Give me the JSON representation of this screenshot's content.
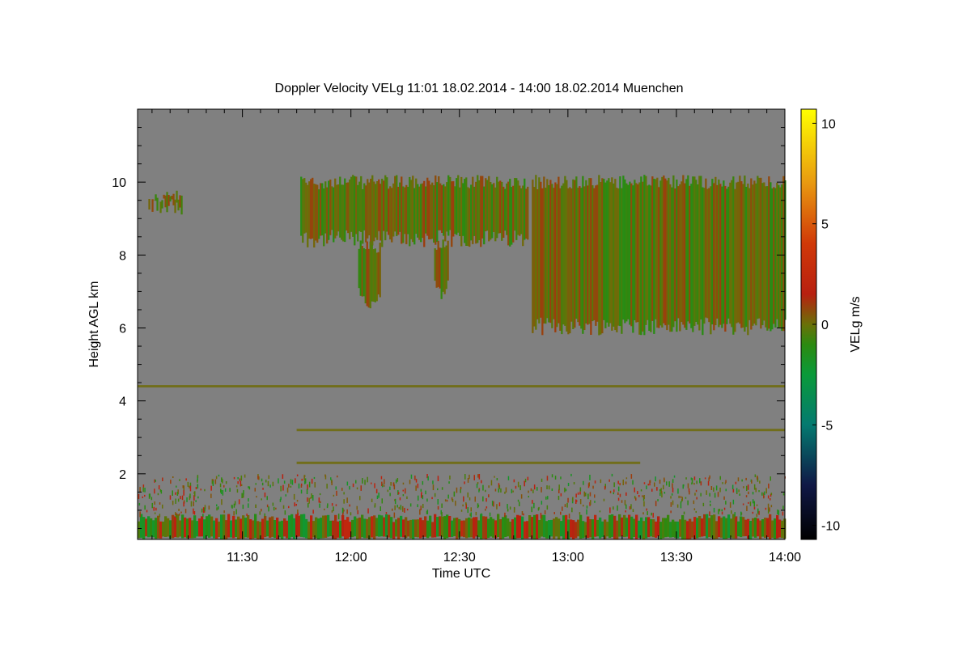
{
  "chart_data": {
    "type": "heatmap",
    "title": "Doppler Velocity VELg   11:01 18.02.2014 - 14:00 18.02.2014 Muenchen",
    "xlabel": "Time UTC",
    "ylabel": "Height AGL km",
    "colorbar_label": "VELg m/s",
    "x_range": [
      "11:01",
      "14:00"
    ],
    "xlim_minutes": [
      661,
      840
    ],
    "ylim_km": [
      0.2,
      12.0
    ],
    "x_ticks": [
      {
        "label": "11:30",
        "minutes": 690
      },
      {
        "label": "12:00",
        "minutes": 720
      },
      {
        "label": "12:30",
        "minutes": 750
      },
      {
        "label": "13:00",
        "minutes": 780
      },
      {
        "label": "13:30",
        "minutes": 810
      },
      {
        "label": "14:00",
        "minutes": 840
      }
    ],
    "y_ticks": [
      {
        "label": "2",
        "value": 2
      },
      {
        "label": "4",
        "value": 4
      },
      {
        "label": "6",
        "value": 6
      },
      {
        "label": "8",
        "value": 8
      },
      {
        "label": "10",
        "value": 10
      }
    ],
    "colorbar_ticks": [
      {
        "label": "10",
        "value": 10
      },
      {
        "label": "5",
        "value": 5
      },
      {
        "label": "0",
        "value": 0
      },
      {
        "label": "-5",
        "value": -5
      },
      {
        "label": "-10",
        "value": -10
      }
    ],
    "colorbar_range": [
      -10.7,
      10.7
    ],
    "background_color": "#808080",
    "colormap": [
      {
        "v": -10.7,
        "c": "#000000"
      },
      {
        "v": -8,
        "c": "#101846"
      },
      {
        "v": -5,
        "c": "#047a70"
      },
      {
        "v": -2.5,
        "c": "#0a9a3a"
      },
      {
        "v": -1,
        "c": "#2c8a10"
      },
      {
        "v": 0,
        "c": "#6a7008"
      },
      {
        "v": 1.5,
        "c": "#b82010"
      },
      {
        "v": 4,
        "c": "#d03808"
      },
      {
        "v": 7,
        "c": "#e89810"
      },
      {
        "v": 10.7,
        "c": "#ffff00"
      }
    ],
    "regions": [
      {
        "name": "cirrus-upper-left",
        "t": [
          664,
          673
        ],
        "h": [
          9.1,
          9.8
        ]
      },
      {
        "name": "cirrus-main-deck",
        "t": [
          706,
          769
        ],
        "h": [
          8.2,
          10.2
        ]
      },
      {
        "name": "fallstreak-1",
        "t": [
          722,
          728
        ],
        "h": [
          6.4,
          8.4
        ]
      },
      {
        "name": "fallstreak-2",
        "t": [
          743,
          747
        ],
        "h": [
          6.7,
          8.5
        ]
      },
      {
        "name": "cirrus-right-deck",
        "t": [
          770,
          840
        ],
        "h": [
          5.8,
          10.2
        ]
      },
      {
        "name": "boundary-layer-clutter",
        "t": [
          661,
          840
        ],
        "h": [
          0.2,
          0.9
        ]
      }
    ],
    "levels": [
      {
        "name": "streak-4.4km",
        "t": [
          661,
          840
        ],
        "h": 4.4
      },
      {
        "name": "streak-3.2km",
        "t": [
          705,
          840
        ],
        "h": 3.2
      },
      {
        "name": "streak-2.3km",
        "t": [
          705,
          800
        ],
        "h": 2.3
      }
    ]
  }
}
